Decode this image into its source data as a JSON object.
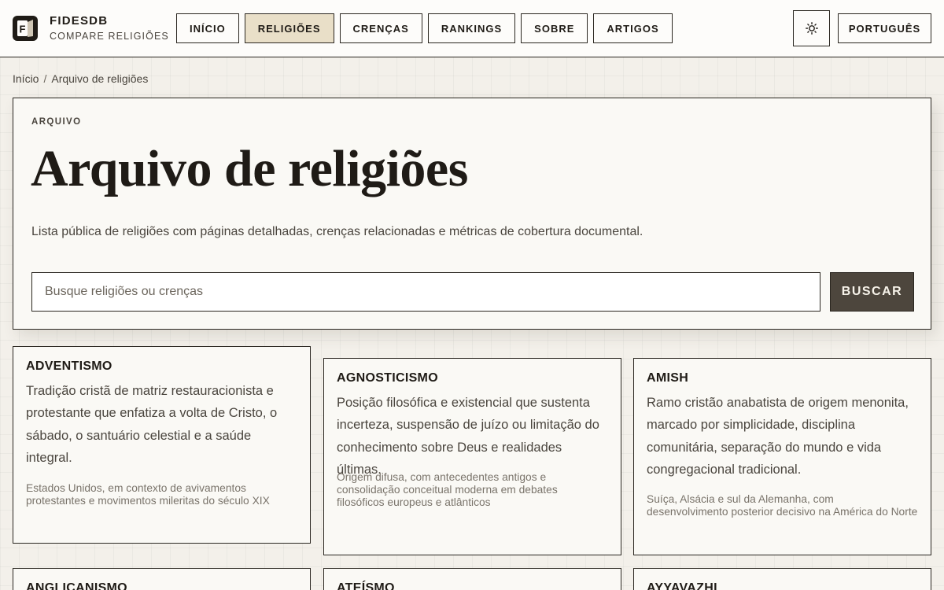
{
  "header": {
    "brand_name": "FIDESDB",
    "brand_sub": "COMPARE RELIGIÕES",
    "logo_letter": "F",
    "nav": [
      {
        "label": "INÍCIO",
        "active": false
      },
      {
        "label": "RELIGIÕES",
        "active": true
      },
      {
        "label": "CRENÇAS",
        "active": false
      },
      {
        "label": "RANKINGS",
        "active": false
      },
      {
        "label": "SOBRE",
        "active": false
      },
      {
        "label": "ARTIGOS",
        "active": false
      }
    ],
    "theme_icon": "sun-icon",
    "language": "PORTUGUÊS"
  },
  "breadcrumb": {
    "home": "Início",
    "separator": "/",
    "current": "Arquivo de religiões"
  },
  "hero": {
    "eyebrow": "ARQUIVO",
    "title": "Arquivo de religiões",
    "description": "Lista pública de religiões com páginas detalhadas, crenças relacionadas e métricas de cobertura documental.",
    "search_placeholder": "Busque religiões ou crenças",
    "search_value": "",
    "search_button": "BUSCAR"
  },
  "cards": [
    {
      "title": "ADVENTISMO",
      "description": "Tradição cristã de matriz restauracionista e protestante que enfatiza a volta de Cristo, o sábado, o santuário celestial e a saúde integral.",
      "origin": "Estados Unidos, em contexto de avivamentos protestantes e movimentos mileritas do século XIX"
    },
    {
      "title": "AGNOSTICISMO",
      "description": "Posição filosófica e existencial que sustenta incerteza, suspensão de juízo ou limitação do conhecimento sobre Deus e realidades últimas.",
      "origin": "Origem difusa, com antecedentes antigos e consolidação conceitual moderna em debates filosóficos europeus e atlânticos"
    },
    {
      "title": "AMISH",
      "description": "Ramo cristão anabatista de origem menonita, marcado por simplicidade, disciplina comunitária, separação do mundo e vida congregacional tradicional.",
      "origin": "Suíça, Alsácia e sul da Alemanha, com desenvolvimento posterior decisivo na América do Norte"
    },
    {
      "title": "ANGLICANISMO"
    },
    {
      "title": "ATEÍSMO"
    },
    {
      "title": "AYYAVAZHI"
    }
  ],
  "colors": {
    "ink": "#1f1b16",
    "muted": "#4a453e",
    "active_nav": "#e9dfc8",
    "search_button_bg": "#4d463d",
    "panel_bg": "#faf9f5"
  }
}
